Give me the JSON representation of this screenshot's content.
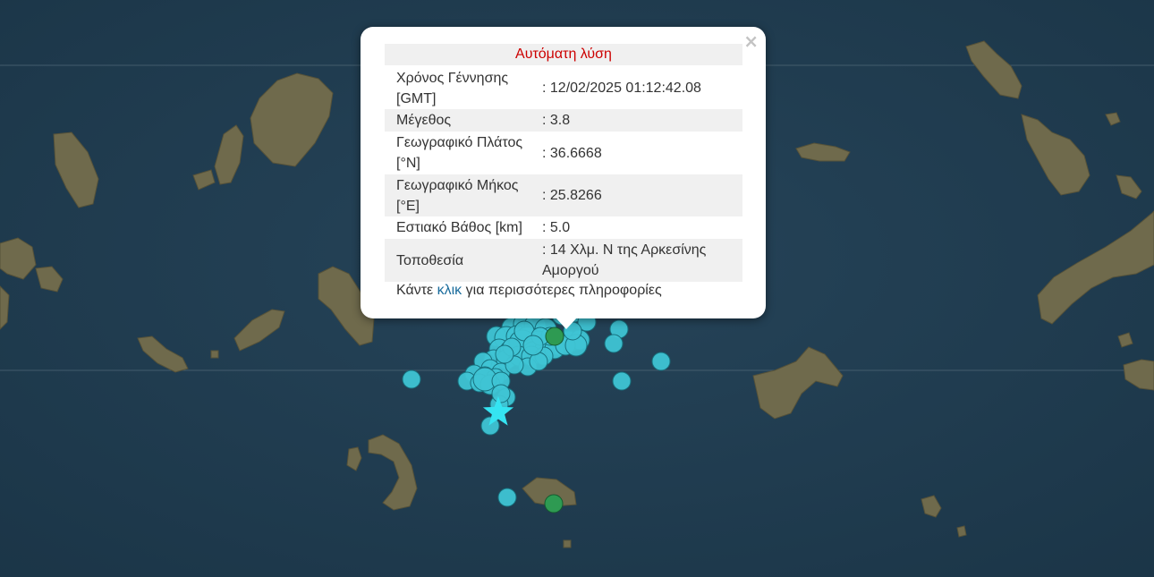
{
  "popup": {
    "close_symbol": "×",
    "title": "Αυτόματη λύση",
    "rows": [
      {
        "label": "Χρόνος Γέννησης [GMT]",
        "value": ": 12/02/2025 01:12:42.08"
      },
      {
        "label": "Μέγεθος",
        "value": ": 3.8"
      },
      {
        "label": "Γεωγραφικό Πλάτος [°N]",
        "value": ": 36.6668"
      },
      {
        "label": "Γεωγραφικό Μήκος [°E]",
        "value": ": 25.8266"
      },
      {
        "label": "Εστιακό Βάθος [km]",
        "value": ": 5.0"
      },
      {
        "label": "Τοποθεσία",
        "value": ": 14 Χλμ. Ν της Αρκεσίνης Αμοργού"
      }
    ],
    "more_prefix": "Κάντε ",
    "more_link": "κλικ",
    "more_suffix": " για περισσότερες πληροφορίες"
  },
  "map": {
    "colors": {
      "sea": "#1f3a4e",
      "land": "#6f6a4c",
      "event_marker": "#3fc4d4",
      "highlight_marker": "#2e9a52",
      "star_marker": "#35e4f2"
    },
    "event_marker_count": 60,
    "highlight_marker_count": 2,
    "star_marker_icon": "star-icon"
  }
}
